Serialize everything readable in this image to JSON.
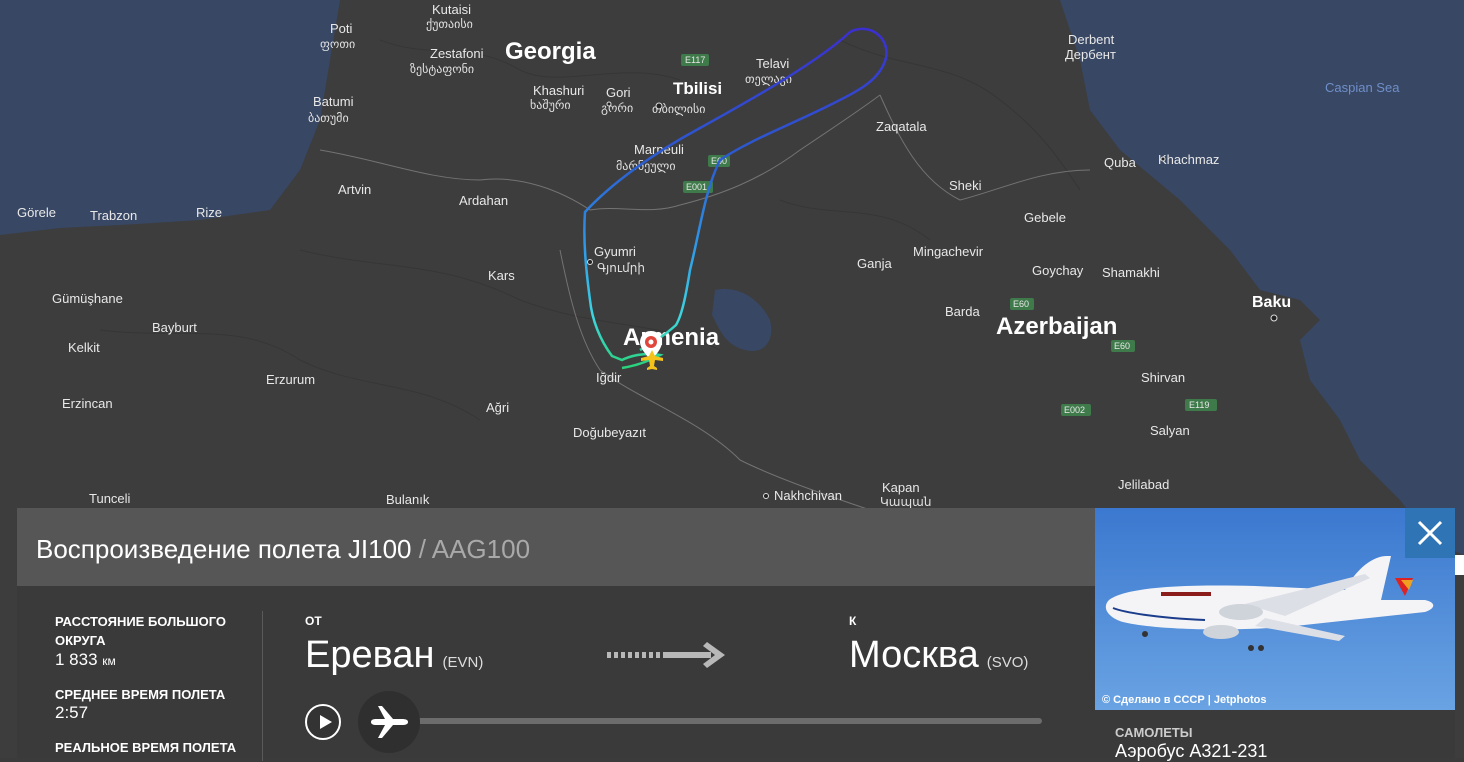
{
  "map": {
    "country_labels": [
      {
        "id": "georgia",
        "text": "Georgia"
      },
      {
        "id": "armenia",
        "text": "Armenia"
      },
      {
        "id": "azerbaijan",
        "text": "Azerbaijan"
      }
    ],
    "sea_label": "Caspian Sea",
    "city_labels": [
      {
        "id": "kutaisi",
        "text": "Kutaisi",
        "alt": "ქუთაისი"
      },
      {
        "id": "poti",
        "text": "Poti",
        "alt": "ფოთი"
      },
      {
        "id": "zestafoni",
        "text": "Zestafoni",
        "alt": "ზესტაფონი"
      },
      {
        "id": "batumi",
        "text": "Batumi",
        "alt": "ბათუმი"
      },
      {
        "id": "khashuri",
        "text": "Khashuri",
        "alt": "ხაშური"
      },
      {
        "id": "gori",
        "text": "Gori",
        "alt": "გორი"
      },
      {
        "id": "tbilisi",
        "text": "Tbilisi",
        "alt": "თბილისი"
      },
      {
        "id": "telavi",
        "text": "Telavi",
        "alt": "თელავი"
      },
      {
        "id": "derbent",
        "text": "Derbent",
        "alt": "Дербент"
      },
      {
        "id": "marneuli",
        "text": "Marneuli",
        "alt": "მარნეული"
      },
      {
        "id": "zaqatala",
        "text": "Zaqatala"
      },
      {
        "id": "quba",
        "text": "Quba"
      },
      {
        "id": "khachmaz",
        "text": "Khachmaz"
      },
      {
        "id": "artvin",
        "text": "Artvin"
      },
      {
        "id": "ardahan",
        "text": "Ardahan"
      },
      {
        "id": "sheki",
        "text": "Sheki"
      },
      {
        "id": "gorele",
        "text": "Görele"
      },
      {
        "id": "trabzon",
        "text": "Trabzon"
      },
      {
        "id": "rize",
        "text": "Rize"
      },
      {
        "id": "gebele",
        "text": "Gebele"
      },
      {
        "id": "gyumri",
        "text": "Gyumri",
        "alt": "Գյումրի"
      },
      {
        "id": "mingachevir",
        "text": "Mingachevir"
      },
      {
        "id": "kars",
        "text": "Kars"
      },
      {
        "id": "ganja",
        "text": "Ganja"
      },
      {
        "id": "goychay",
        "text": "Goychay"
      },
      {
        "id": "shamakhi",
        "text": "Shamakhi"
      },
      {
        "id": "gumushane",
        "text": "Gümüşhane"
      },
      {
        "id": "baku",
        "text": "Baku"
      },
      {
        "id": "barda",
        "text": "Barda"
      },
      {
        "id": "bayburt",
        "text": "Bayburt"
      },
      {
        "id": "kelkit",
        "text": "Kelkit"
      },
      {
        "id": "igdir",
        "text": "Iğdir"
      },
      {
        "id": "erzurum",
        "text": "Erzurum"
      },
      {
        "id": "shirvan",
        "text": "Shirvan"
      },
      {
        "id": "erzincan",
        "text": "Erzincan"
      },
      {
        "id": "agri",
        "text": "Ağri"
      },
      {
        "id": "salyan",
        "text": "Salyan"
      },
      {
        "id": "dogubayazit",
        "text": "Doğubeyazıt"
      },
      {
        "id": "jalilabad",
        "text": "Jelilabad"
      },
      {
        "id": "tunceli",
        "text": "Tunceli"
      },
      {
        "id": "bulanik",
        "text": "Bulanık"
      },
      {
        "id": "nakhchivan",
        "text": "Nakhchivan"
      },
      {
        "id": "kapan",
        "text": "Kapan",
        "alt": "Կապան"
      }
    ],
    "road_labels": [
      "E117",
      "E60",
      "E001",
      "E60",
      "E60",
      "E002",
      "E119"
    ]
  },
  "flight": {
    "title_prefix": "Воспроизведение полета ",
    "flight_number": "JI100",
    "separator": " / ",
    "callsign": "AAG100",
    "stats": [
      {
        "label": "Расстояние большого округа",
        "value": "1 833",
        "unit": "км"
      },
      {
        "label": "Среднее время полета",
        "value": "2:57"
      },
      {
        "label": "Реальное время полета",
        "value": ""
      }
    ],
    "from_label": "ОТ",
    "to_label": "К",
    "origin": {
      "city": "Ереван",
      "code": "(EVN)"
    },
    "destination": {
      "city": "Москва",
      "code": "(SVO)"
    },
    "playback_progress": 0
  },
  "aircraft": {
    "photo_credit": "© Сделано в СССР | Jetphotos",
    "label": "Самолеты",
    "value": "Аэробус A321-231"
  },
  "colors": {
    "accent": "#2f75b5",
    "panel_head": "#565656",
    "panel_body": "#3a3a3a"
  }
}
